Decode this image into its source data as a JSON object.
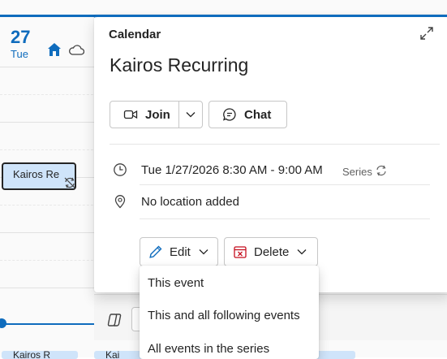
{
  "calendar": {
    "day_number": "27",
    "day_name": "Tue",
    "event_title": "Kairos Re",
    "bottom_event_1": "Kairos R",
    "bottom_event_2": "Kai"
  },
  "peek": {
    "category": "Calendar",
    "title": "Kairos Recurring",
    "join_label": "Join",
    "chat_label": "Chat",
    "datetime": "Tue 1/27/2026 8:30 AM - 9:00 AM",
    "series_label": "Series",
    "location": "No location added",
    "edit_label": "Edit",
    "delete_label": "Delete"
  },
  "edit_menu": {
    "items": [
      "This event",
      "This and all following events",
      "All events in the series"
    ]
  },
  "colors": {
    "accent": "#0f6cbd",
    "event_fill": "#cfe4fa",
    "delete_red": "#c50f1f"
  },
  "icons": [
    "home-icon",
    "cloud-icon",
    "recurring-exception-icon",
    "expand-icon",
    "video-icon",
    "chevron-down-icon",
    "chat-icon",
    "clock-icon",
    "recurring-icon",
    "location-icon",
    "pen-icon",
    "calendar-delete-icon",
    "copilot-icon"
  ]
}
